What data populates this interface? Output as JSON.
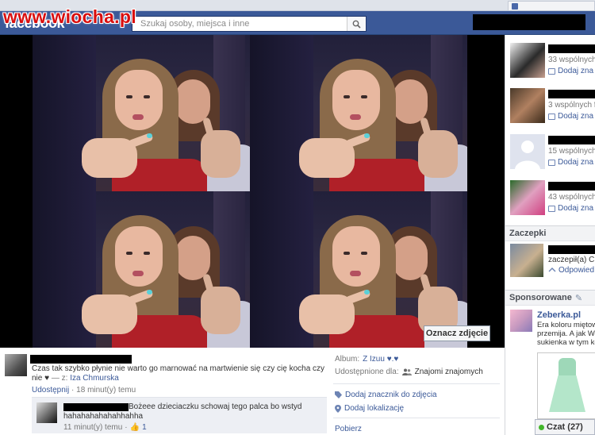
{
  "watermark": "www.wiocha.pl",
  "browser": {
    "tab_text": ""
  },
  "header": {
    "logo": "facebook",
    "search_placeholder": "Szukaj osoby, miejsca i inne"
  },
  "photo": {
    "tag_button": "Oznacz zdjęcie"
  },
  "post": {
    "caption": "Czas tak szybko płynie nie warto go marnować na martwienie się czy cię kocha czy nie ♥",
    "with_prefix": "— z:",
    "with_name": "Iza Chmurska",
    "share_link": "Udostępnij",
    "separator": "·",
    "time": "18 minut(y) temu"
  },
  "comment": {
    "text": "Bożeee dzieciaczku schowaj tego palca bo wstyd hahahahahahahhahha",
    "time": "11 minut(y) temu",
    "separator": "·",
    "likes": "1"
  },
  "right_meta": {
    "album_label": "Album:",
    "album_name": "Z Izuu ♥.♥",
    "shared_label": "Udostępnione dla:",
    "shared_value": "Znajomi znajomych",
    "tag_link": "Dodaj znacznik do zdjęcia",
    "location_link": "Dodaj lokalizację",
    "download_link": "Pobierz"
  },
  "sidebar": {
    "friends": [
      {
        "mutual": "33 wspólnych",
        "add": "Dodaj zna"
      },
      {
        "mutual": "3 wspólnych fa",
        "add": "Dodaj zna"
      },
      {
        "mutual": "15 wspólnych",
        "add": "Dodaj zna"
      },
      {
        "mutual": "43 wspólnych",
        "add": "Dodaj zna"
      }
    ],
    "pokes_title": "Zaczepki",
    "poke": {
      "text": "zaczepił(a) Cię",
      "reply": "Odpowied"
    },
    "sponsored_title": "Sponsorowane",
    "ad": {
      "title": "Zeberka.pl",
      "lines": [
        "Era koloru miętowe",
        "przemija. A jak Wa",
        "sukienka w tym ko"
      ]
    }
  },
  "chat": {
    "label": "Czat (27)"
  },
  "colors": {
    "fb_blue": "#3b5998",
    "link_blue": "#3b5998",
    "watermark_red": "#d90e0e"
  }
}
